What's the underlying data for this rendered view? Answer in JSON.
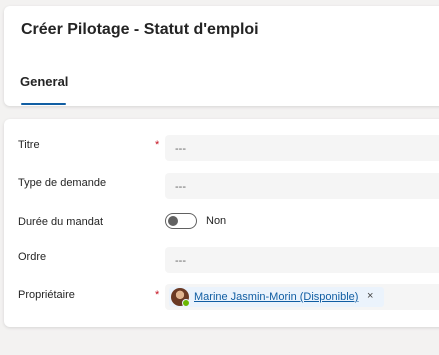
{
  "header": {
    "title": "Créer Pilotage - Statut d'emploi",
    "tabs": [
      {
        "label": "General",
        "selected": true
      }
    ]
  },
  "form": {
    "fields": [
      {
        "label": "Titre",
        "required": true,
        "value": "---"
      },
      {
        "label": "Type de demande",
        "required": false,
        "value": "---"
      },
      {
        "label": "Durée du mandat",
        "required": false,
        "toggle_on": false,
        "toggle_label": "Non"
      },
      {
        "label": "Ordre",
        "required": false,
        "value": "---"
      },
      {
        "label": "Propriétaire",
        "required": true,
        "owner": "Marine Jasmin-Morin (Disponible)",
        "remove_icon": "×"
      }
    ],
    "required_marker": "*"
  },
  "colors": {
    "accent": "#115ea3",
    "required": "#c50f1f",
    "presence_available": "#6bb700",
    "input_background": "#f5f5f5"
  }
}
